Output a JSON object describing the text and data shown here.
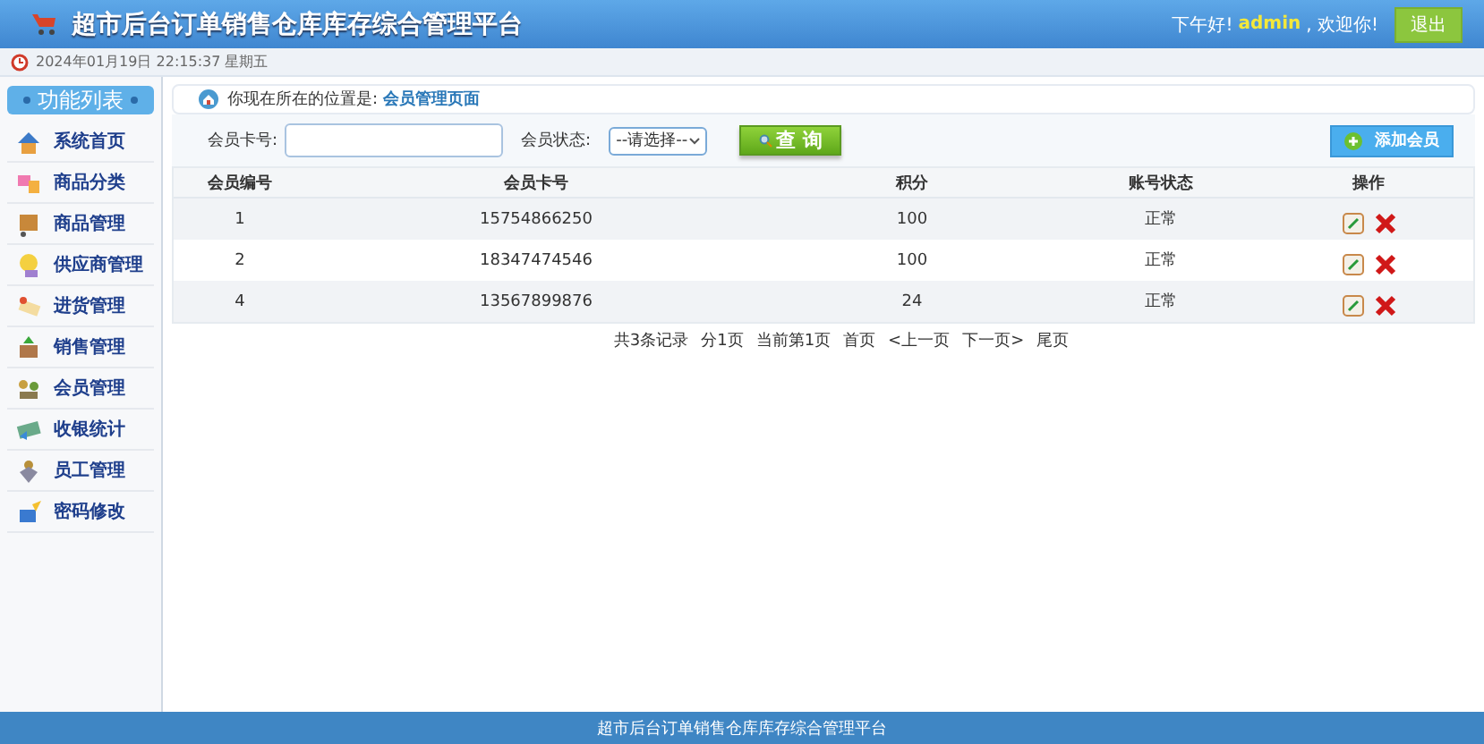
{
  "header": {
    "title": "超市后台订单销售仓库库存综合管理平台",
    "greeting": "下午好!",
    "user": "admin",
    "welcome": ", 欢迎你!",
    "logout": "退出"
  },
  "datebar": {
    "datetime": "2024年01月19日 22:15:37 星期五"
  },
  "sidebar": {
    "title": "功能列表",
    "items": [
      {
        "label": "系统首页"
      },
      {
        "label": "商品分类"
      },
      {
        "label": "商品管理"
      },
      {
        "label": "供应商管理"
      },
      {
        "label": "进货管理"
      },
      {
        "label": "销售管理"
      },
      {
        "label": "会员管理"
      },
      {
        "label": "收银统计"
      },
      {
        "label": "员工管理"
      },
      {
        "label": "密码修改"
      }
    ]
  },
  "breadcrumb": {
    "label": "你现在所在的位置是:",
    "current": "会员管理页面"
  },
  "filters": {
    "card_label": "会员卡号:",
    "status_label": "会员状态:",
    "status_value": "--请选择--",
    "search_button": "查 询",
    "add_button": "添加会员"
  },
  "table": {
    "columns": [
      "会员编号",
      "会员卡号",
      "积分",
      "账号状态",
      "操作"
    ],
    "rows": [
      {
        "id": "1",
        "card": "15754866250",
        "points": "100",
        "status": "正常"
      },
      {
        "id": "2",
        "card": "18347474546",
        "points": "100",
        "status": "正常"
      },
      {
        "id": "4",
        "card": "13567899876",
        "points": "24",
        "status": "正常"
      }
    ]
  },
  "pagination": {
    "total": "共3条记录",
    "pages": "分1页",
    "current": "当前第1页",
    "links": [
      "首页",
      "<上一页",
      "下一页>",
      "尾页"
    ]
  },
  "footer": {
    "text": "超市后台订单销售仓库库存综合管理平台"
  }
}
